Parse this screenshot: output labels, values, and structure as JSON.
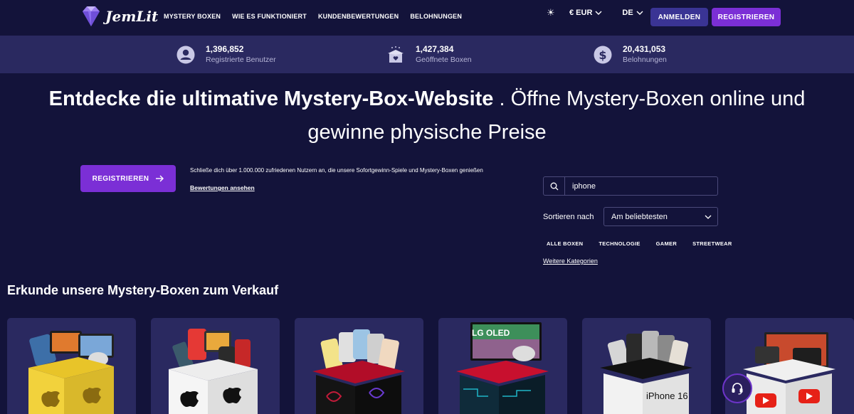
{
  "nav": {
    "brand": "JemLit",
    "links": [
      "MYSTERY BOXEN",
      "WIE ES FUNKTIONIERT",
      "KUNDENBEWERTUNGEN",
      "BELOHNUNGEN"
    ],
    "currency": "€ EUR",
    "language": "DE",
    "login_label": "ANMELDEN",
    "register_label": "REGISTRIEREN"
  },
  "stats": [
    {
      "value": "1,396,852",
      "label": "Registrierte Benutzer",
      "icon": "user-icon"
    },
    {
      "value": "1,427,384",
      "label": "Geöffnete Boxen",
      "icon": "open-box-icon"
    },
    {
      "value": "20,431,053",
      "label": "Belohnungen",
      "icon": "dollar-icon"
    }
  ],
  "hero": {
    "headline_bold": "Entdecke die ultimative Mystery-Box-Website",
    "headline_rest": " . Öffne Mystery-Boxen online und gewinne physische Preise",
    "register_label": "REGISTRIEREN",
    "join_text": "Schließe dich über 1.000.000 zufriedenen Nutzern an, die unsere Sofortgewinn-Spiele und Mystery-Boxen genießen",
    "reviews_link": "Bewertungen ansehen"
  },
  "filters": {
    "search_value": "iphone",
    "sort_label": "Sortieren nach",
    "sort_value": "Am beliebtesten",
    "categories": [
      "ALLE BOXEN",
      "TECHNOLOGIE",
      "GAMER",
      "STREETWEAR"
    ],
    "more_categories": "Weitere Kategorien"
  },
  "section_title": "Erkunde unsere Mystery-Boxen zum Verkauf",
  "boxes": [
    {
      "box_color": "#f2d23c",
      "theme": "apple-yellow",
      "label": ""
    },
    {
      "box_color": "#f2f2f2",
      "theme": "apple-white",
      "label": ""
    },
    {
      "box_color": "#c8102e",
      "theme": "iphone-red",
      "label": ""
    },
    {
      "box_color": "#c8102e",
      "theme": "lg-oled",
      "label": "LG OLED"
    },
    {
      "box_color": "#f2f2f2",
      "theme": "iphone16",
      "label": "iPhone 16"
    },
    {
      "box_color": "#e23a3a",
      "theme": "youtube",
      "label": ""
    }
  ],
  "colors": {
    "background": "#13133a",
    "stats_bar": "#2a2960",
    "accent_purple": "#7b2fd6",
    "login_blue": "#3a3494"
  }
}
